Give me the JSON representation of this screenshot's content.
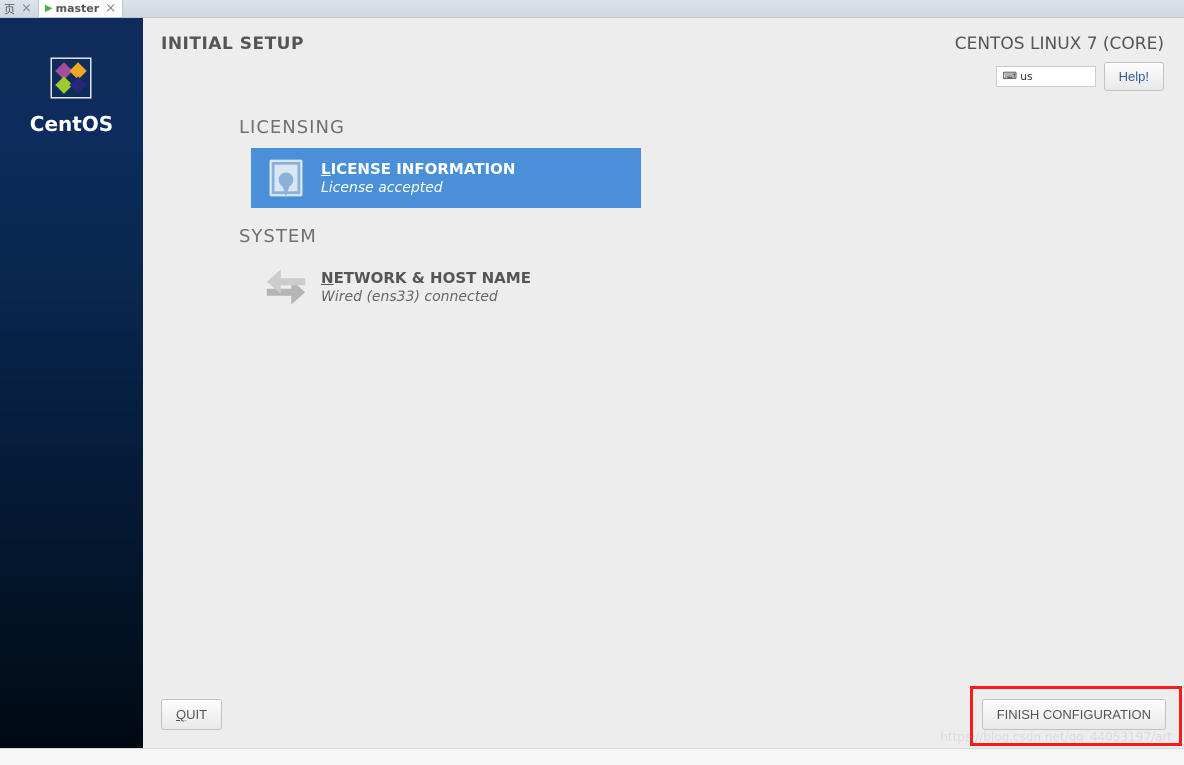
{
  "tabs": [
    {
      "label": "页",
      "active": false
    },
    {
      "label": "master",
      "active": true
    }
  ],
  "sidebar": {
    "brand": "CentOS"
  },
  "header": {
    "title": "INITIAL SETUP",
    "distro": "CENTOS LINUX 7 (CORE)",
    "keyboard_layout": "us",
    "help_label": "Help!"
  },
  "sections": {
    "licensing": {
      "header": "LICENSING",
      "item": {
        "title_prefix": "L",
        "title_rest": "ICENSE INFORMATION",
        "subtitle": "License accepted"
      }
    },
    "system": {
      "header": "SYSTEM",
      "item": {
        "title_prefix": "N",
        "title_rest": "ETWORK & HOST NAME",
        "subtitle": "Wired (ens33) connected"
      }
    }
  },
  "footer": {
    "quit_prefix": "Q",
    "quit_rest": "UIT",
    "finish_label": "FINISH CONFIGURATION"
  },
  "watermark": "https://blog.csdn.net/qq_44053197/art"
}
